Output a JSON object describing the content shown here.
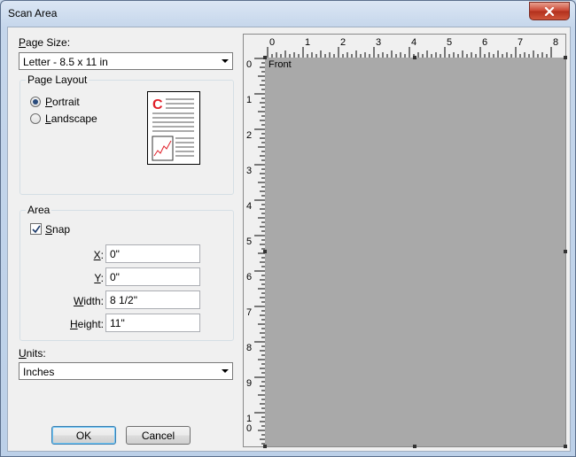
{
  "window": {
    "title": "Scan Area"
  },
  "page_size": {
    "label": "Page Size:",
    "selected": "Letter - 8.5 x 11 in"
  },
  "page_layout": {
    "title": "Page Layout",
    "portrait_label": "Portrait",
    "landscape_label": "Landscape",
    "selected": "Portrait",
    "preview_letter": "C"
  },
  "area": {
    "title": "Area",
    "snap_label": "Snap",
    "snap_checked": true,
    "x_label": "X:",
    "x_value": "0\"",
    "y_label": "Y:",
    "y_value": "0\"",
    "width_label": "Width:",
    "width_value": "8 1/2\"",
    "height_label": "Height:",
    "height_value": "11\""
  },
  "units": {
    "label": "Units:",
    "selected": "Inches"
  },
  "buttons": {
    "ok": "OK",
    "cancel": "Cancel"
  },
  "preview": {
    "page_label": "Front",
    "h_ruler_numbers": [
      "0",
      "1",
      "2",
      "3",
      "4",
      "5",
      "6",
      "7",
      "8"
    ],
    "v_ruler_numbers": [
      "0",
      "1",
      "2",
      "3",
      "4",
      "5",
      "6",
      "7",
      "8",
      "9",
      "10"
    ]
  },
  "colors": {
    "accent_red": "#e0202a",
    "page_gray": "#a9a9a9",
    "dialog_bg": "#f0f0f0"
  },
  "icons": {
    "close": "close-icon",
    "dropdown": "chevron-down-icon",
    "check": "checkmark-icon"
  }
}
